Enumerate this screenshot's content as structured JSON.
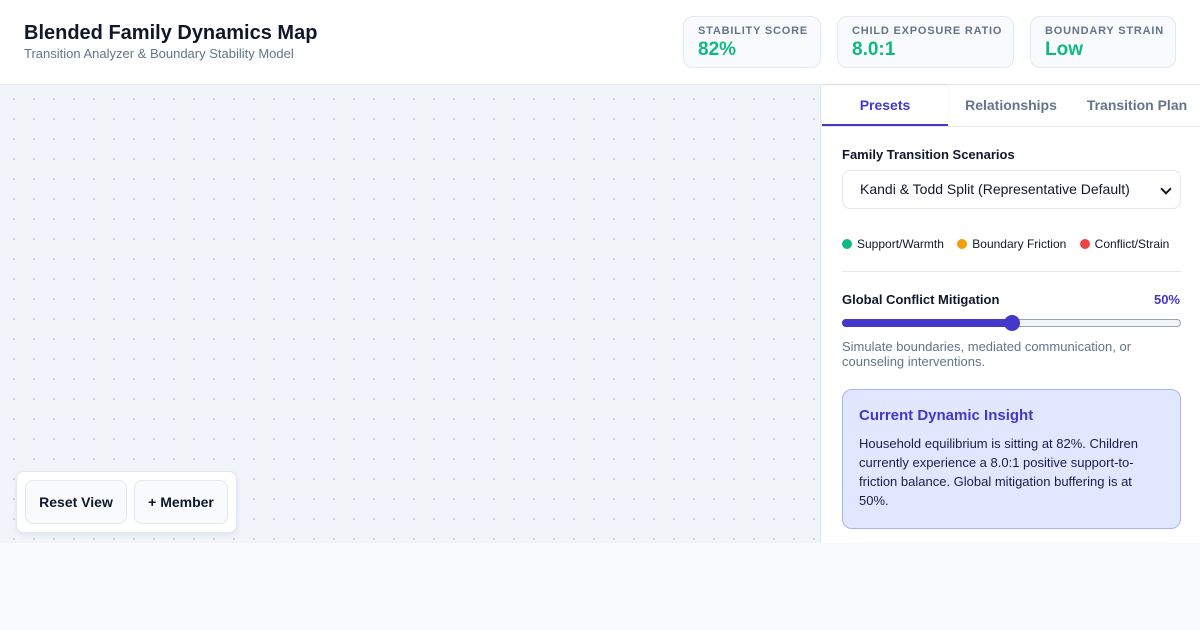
{
  "header": {
    "title": "Blended Family Dynamics Map",
    "subtitle": "Transition Analyzer & Boundary Stability Model"
  },
  "metrics": [
    {
      "label": "STABILITY SCORE",
      "value": "82%"
    },
    {
      "label": "CHILD EXPOSURE RATIO",
      "value": "8.0:1"
    },
    {
      "label": "BOUNDARY STRAIN",
      "value": "Low"
    }
  ],
  "metric_color": "#10b981",
  "canvas": {
    "reset_label": "Reset View",
    "add_member_label": "+ Member"
  },
  "panel": {
    "tabs": [
      {
        "label": "Presets",
        "active": true
      },
      {
        "label": "Relationships",
        "active": false
      },
      {
        "label": "Transition Plan",
        "active": false
      }
    ],
    "scenarios_label": "Family Transition Scenarios",
    "scenario_selected": "Kandi & Todd Split (Representative Default)",
    "legend": [
      {
        "label": "Support/Warmth",
        "color": "#10b981"
      },
      {
        "label": "Boundary Friction",
        "color": "#f59e0b"
      },
      {
        "label": "Conflict/Strain",
        "color": "#ef4444"
      }
    ],
    "mitigation_label": "Global Conflict Mitigation",
    "mitigation_value_text": "50%",
    "mitigation_level": 0.5,
    "mitigation_note": "Simulate boundaries, mediated communication, or counseling interventions.",
    "insight_title": "Current Dynamic Insight",
    "insight_body": "Household equilibrium is sitting at 82%. Children currently experience a 8.0:1 positive support-to-friction balance. Global mitigation buffering is at 50%."
  },
  "accent_color": "#4338ca"
}
